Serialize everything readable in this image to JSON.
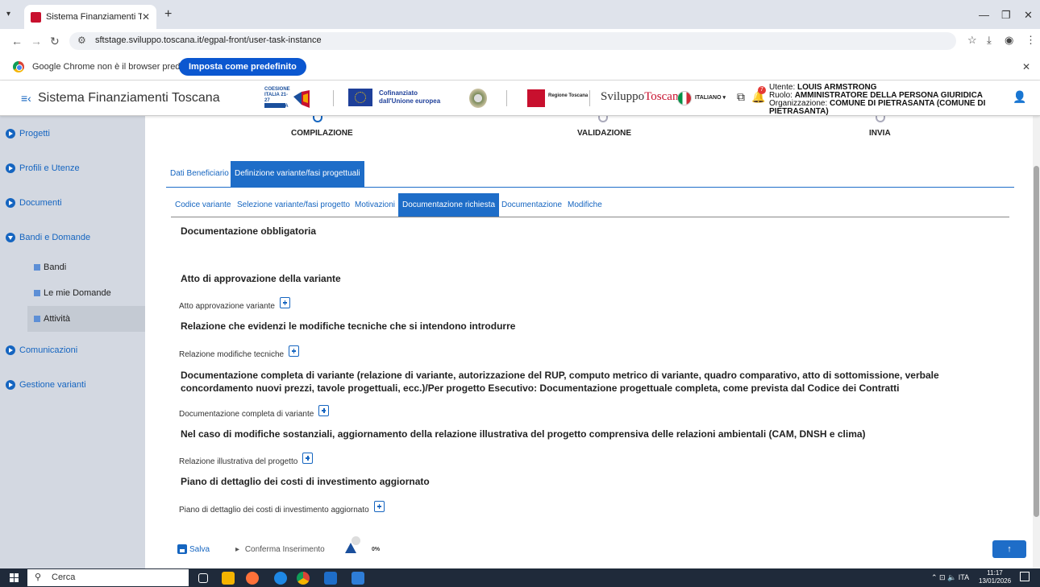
{
  "browser": {
    "tab_title": "Sistema Finanziamenti Toscana",
    "url": "sftstage.sviluppo.toscana.it/egpal-front/user-task-instance",
    "infobar_text": "Google Chrome non è il browser predefinito",
    "infobar_button": "Imposta come predefinito"
  },
  "header": {
    "title": "Sistema Finanziamenti Toscana",
    "coesione_text": "COESIONE ITALIA 21-27 TOSCANA",
    "eu_text_1": "Cofinanziato",
    "eu_text_2": "dall'Unione europea",
    "regione_text": "Regione Toscana",
    "sviluppo_1": "Sviluppo",
    "sviluppo_2": "Toscana",
    "language": "ITALIANO",
    "notification_count": "7",
    "user_label": "Utente: ",
    "user_name": "LOUIS ARMSTRONG",
    "role_label": "Ruolo: ",
    "role_name": "AMMINISTRATORE DELLA PERSONA GIURIDICA",
    "org_label": "Organizzazione: ",
    "org_name": "COMUNE DI PIETRASANTA (COMUNE DI PIETRASANTA)"
  },
  "sidebar": {
    "items": [
      {
        "label": "Progetti"
      },
      {
        "label": "Profili e Utenze"
      },
      {
        "label": "Documenti"
      },
      {
        "label": "Bandi e Domande"
      },
      {
        "label": "Comunicazioni"
      },
      {
        "label": "Gestione varianti"
      }
    ],
    "subitems": [
      {
        "label": "Bandi"
      },
      {
        "label": "Le mie Domande"
      },
      {
        "label": "Attività"
      }
    ]
  },
  "stepper": {
    "steps": [
      {
        "label": "COMPILAZIONE"
      },
      {
        "label": "VALIDAZIONE"
      },
      {
        "label": "INVIA"
      }
    ]
  },
  "tabs_main": [
    {
      "label": "Dati Beneficiario"
    },
    {
      "label": "Definizione variante/fasi progettuali"
    }
  ],
  "tabs_sub": [
    {
      "label": "Codice variante"
    },
    {
      "label": "Selezione variante/fasi progetto"
    },
    {
      "label": "Motivazioni"
    },
    {
      "label": "Documentazione richiesta"
    },
    {
      "label": "Documentazione"
    },
    {
      "label": "Modifiche"
    }
  ],
  "content": {
    "heading": "Documentazione obbligatoria",
    "sections": [
      {
        "title": "Atto di approvazione della variante",
        "doc": "Atto approvazione variante"
      },
      {
        "title": "Relazione che evidenzi le modifiche tecniche che si intendono introdurre",
        "doc": "Relazione modifiche tecniche"
      },
      {
        "title": "Documentazione completa di variante (relazione di variante, autorizzazione del RUP, computo metrico di variante, quadro comparativo, atto di sottomissione, verbale concordamento nuovi prezzi, tavole progettuali, ecc.)/Per progetto Esecutivo: Documentazione progettuale completa, come prevista dal Codice dei Contratti",
        "doc": "Documentazione completa di variante"
      },
      {
        "title": "Nel caso di modifiche sostanziali, aggiornamento della relazione illustrativa del progetto comprensiva delle relazioni ambientali (CAM, DNSH e clima)",
        "doc": "Relazione illustrativa del progetto"
      },
      {
        "title": "Piano di dettaglio dei costi di investimento aggiornato",
        "doc": "Piano di dettaglio dei costi di investimento aggiornato"
      }
    ]
  },
  "footer": {
    "save_label": "Salva",
    "confirm_label": "Conferma Inserimento",
    "progress": "0%",
    "to_top": "↑"
  },
  "taskbar": {
    "search_placeholder": "Cerca",
    "lang": "ITA",
    "time": "11:17",
    "date": "13/01/2026"
  }
}
